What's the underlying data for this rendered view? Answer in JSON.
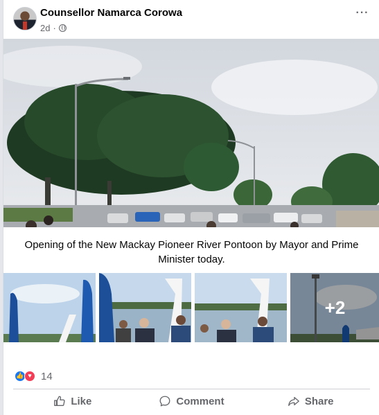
{
  "post": {
    "author": "Counsellor Namarca Corowa",
    "time": "2d",
    "separator": "·",
    "more_icon": "···",
    "caption": "Opening of the New Mackay Pioneer River Pontoon by Mayor and Prime Minister today.",
    "extra_photos": "+2"
  },
  "reactions": {
    "count": "14"
  },
  "actions": {
    "like": "Like",
    "comment": "Comment",
    "share": "Share"
  },
  "icons": {
    "privacy": "globe-icon",
    "like": "thumbs-up-icon",
    "comment": "speech-bubble-icon",
    "share": "share-arrow-icon"
  }
}
